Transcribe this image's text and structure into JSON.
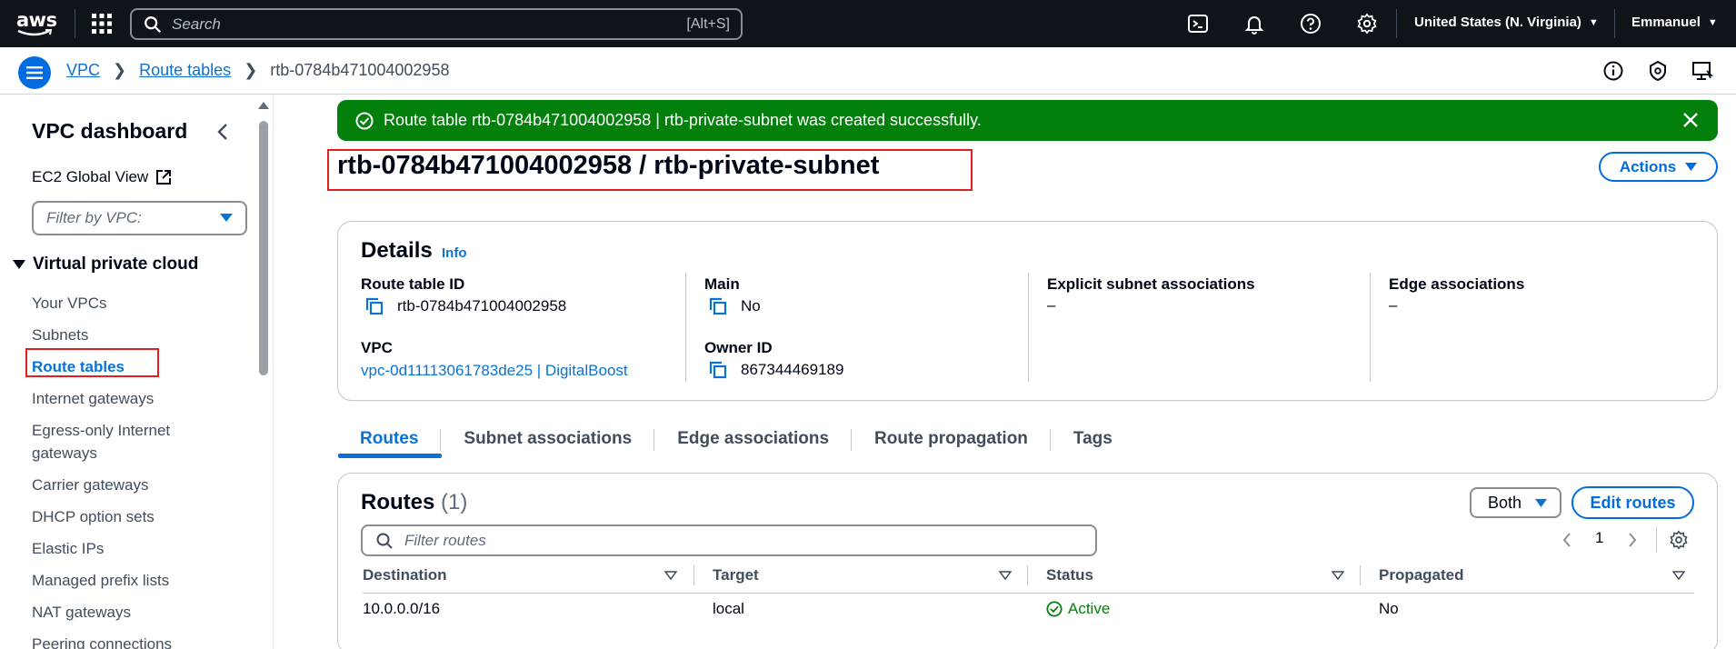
{
  "topnav": {
    "logo_text": "aws",
    "search_placeholder": "Search",
    "search_shortcut": "[Alt+S]",
    "region": "United States (N. Virginia)",
    "user": "Emmanuel"
  },
  "breadcrumb": {
    "items": [
      "VPC",
      "Route tables"
    ],
    "current": "rtb-0784b471004002958"
  },
  "sidebar": {
    "title": "VPC dashboard",
    "ec2_global_view": "EC2 Global View",
    "filter_placeholder": "Filter by VPC:",
    "section": "Virtual private cloud",
    "items": [
      "Your VPCs",
      "Subnets",
      "Route tables",
      "Internet gateways",
      "Egress-only Internet gateways",
      "Carrier gateways",
      "DHCP option sets",
      "Elastic IPs",
      "Managed prefix lists",
      "NAT gateways",
      "Peering connections"
    ],
    "active_item": "Route tables"
  },
  "flash": {
    "message": "Route table rtb-0784b471004002958 | rtb-private-subnet was created successfully.",
    "color": "#037f0c"
  },
  "page": {
    "title": "rtb-0784b471004002958 / rtb-private-subnet",
    "actions_label": "Actions"
  },
  "details": {
    "title": "Details",
    "info": "Info",
    "route_table_id_label": "Route table ID",
    "route_table_id": "rtb-0784b471004002958",
    "main_label": "Main",
    "main": "No",
    "explicit_label": "Explicit subnet associations",
    "explicit": "–",
    "edge_label": "Edge associations",
    "edge": "–",
    "vpc_label": "VPC",
    "vpc": "vpc-0d11113061783de25 | DigitalBoost",
    "owner_label": "Owner ID",
    "owner": "867344469189"
  },
  "tabs": [
    "Routes",
    "Subnet associations",
    "Edge associations",
    "Route propagation",
    "Tags"
  ],
  "routes": {
    "title": "Routes",
    "count": "(1)",
    "filter_select": "Both",
    "edit_label": "Edit routes",
    "filter_placeholder": "Filter routes",
    "page": "1",
    "columns": [
      "Destination",
      "Target",
      "Status",
      "Propagated"
    ],
    "rows": [
      {
        "destination": "10.0.0.0/16",
        "target": "local",
        "status": "Active",
        "propagated": "No"
      }
    ]
  },
  "colors": {
    "accent": "#0972d3",
    "nav_bg": "#0f141a",
    "success": "#037f0c",
    "highlight_box": "#e02020"
  }
}
